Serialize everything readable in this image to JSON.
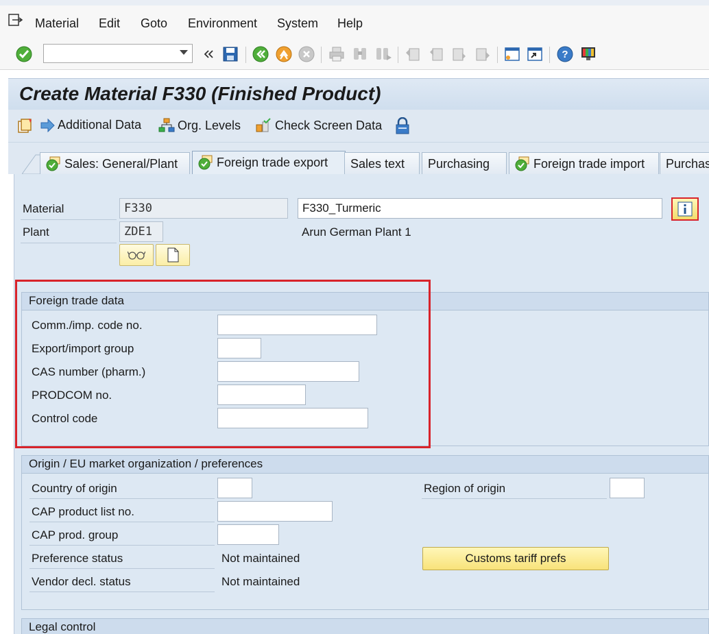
{
  "menu": {
    "items": [
      "Material",
      "Edit",
      "Goto",
      "Environment",
      "System",
      "Help"
    ]
  },
  "toolbar": {
    "command_field_value": "",
    "icons": [
      "enter-icon",
      "save-icon",
      "back-icon",
      "exit-icon",
      "cancel-icon",
      "print-icon",
      "find-icon",
      "find-next-icon",
      "first-page-icon",
      "previous-page-icon",
      "next-page-icon",
      "last-page-icon",
      "create-session-icon",
      "shortcut-icon",
      "help-icon",
      "customize-layout-icon"
    ]
  },
  "title": "Create Material F330 (Finished Product)",
  "app_toolbar": {
    "additional_data": "Additional Data",
    "org_levels": "Org. Levels",
    "check_screen_data": "Check Screen Data"
  },
  "tabs": [
    {
      "label": "Sales: General/Plant",
      "checked": true,
      "active": false
    },
    {
      "label": "Foreign trade export",
      "checked": true,
      "active": true
    },
    {
      "label": "Sales text",
      "checked": false,
      "active": false
    },
    {
      "label": "Purchasing",
      "checked": false,
      "active": false
    },
    {
      "label": "Foreign trade import",
      "checked": true,
      "active": false
    },
    {
      "label": "Purchas",
      "checked": false,
      "active": false
    }
  ],
  "header": {
    "material_label": "Material",
    "material_value": "F330",
    "material_description": "F330_Turmeric",
    "plant_label": "Plant",
    "plant_value": "ZDE1",
    "plant_description": "Arun German Plant 1"
  },
  "foreign_trade": {
    "title": "Foreign trade data",
    "fields": [
      {
        "label": "Comm./imp. code no.",
        "value": ""
      },
      {
        "label": "Export/import group",
        "value": ""
      },
      {
        "label": "CAS number (pharm.)",
        "value": ""
      },
      {
        "label": "PRODCOM no.",
        "value": ""
      },
      {
        "label": "Control code",
        "value": ""
      }
    ]
  },
  "origin": {
    "title": "Origin / EU market organization / preferences",
    "country_of_origin_label": "Country of origin",
    "country_of_origin_value": "",
    "region_of_origin_label": "Region of origin",
    "region_of_origin_value": "",
    "cap_product_list_label": "CAP product list no.",
    "cap_product_list_value": "",
    "cap_prod_group_label": "CAP prod. group",
    "cap_prod_group_value": "",
    "preference_status_label": "Preference status",
    "preference_status_value": "Not maintained",
    "vendor_decl_label": "Vendor decl. status",
    "vendor_decl_value": "Not maintained",
    "customs_button": "Customs tariff prefs"
  },
  "legal_control": {
    "title": "Legal control"
  },
  "colors": {
    "highlight": "#d8232a",
    "panel_bg": "#dde8f3",
    "button_yellow": "#f8e27a"
  }
}
